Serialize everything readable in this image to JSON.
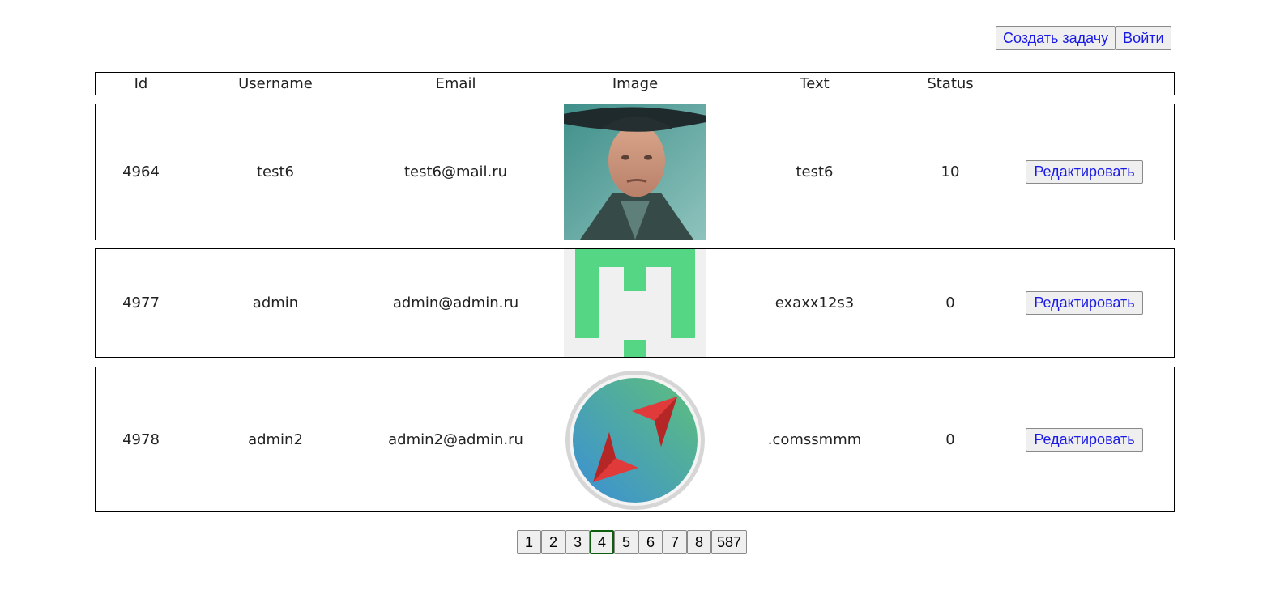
{
  "header": {
    "create_task_label": "Создать задачу",
    "login_label": "Войти"
  },
  "table": {
    "columns": {
      "id": "Id",
      "username": "Username",
      "email": "Email",
      "image": "Image",
      "text": "Text",
      "status": "Status"
    },
    "rows": [
      {
        "id": "4964",
        "username": "test6",
        "email": "test6@mail.ru",
        "image": "photo-portrait",
        "text": "test6",
        "status": "10",
        "edit_label": "Редактировать"
      },
      {
        "id": "4977",
        "username": "admin",
        "email": "admin@admin.ru",
        "image": "green-h-logo",
        "text": "exaxx12s3",
        "status": "0",
        "edit_label": "Редактировать"
      },
      {
        "id": "4978",
        "username": "admin2",
        "email": "admin2@admin.ru",
        "image": "red-arrows-circle-logo",
        "text": ".comssmmm",
        "status": "0",
        "edit_label": "Редактировать"
      }
    ]
  },
  "pagination": {
    "pages": [
      "1",
      "2",
      "3",
      "4",
      "5",
      "6",
      "7",
      "8",
      "587"
    ],
    "current": "4"
  },
  "colors": {
    "link_blue": "#1a1ae6",
    "active_page_border": "#0f5e0f",
    "logo_green": "#55d685"
  }
}
